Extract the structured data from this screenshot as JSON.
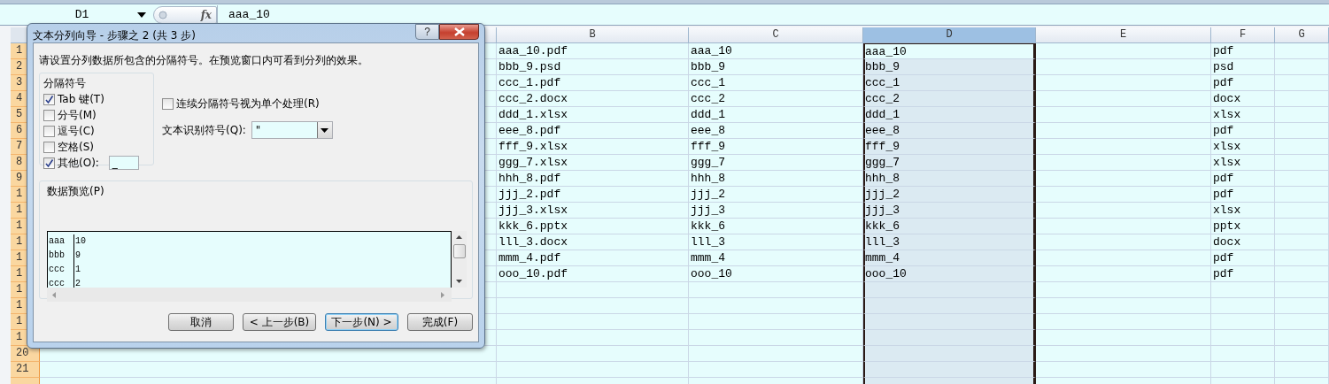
{
  "formula_bar": {
    "name_box": "D1",
    "function_label": "fx",
    "formula": "aaa_10"
  },
  "sheet": {
    "columns": [
      {
        "label": "B",
        "selected": false
      },
      {
        "label": "C",
        "selected": false
      },
      {
        "label": "D",
        "selected": true
      },
      {
        "label": "E",
        "selected": false
      },
      {
        "label": "F",
        "selected": false
      },
      {
        "label": "G",
        "selected": false
      }
    ],
    "rows": [
      {
        "header": "1",
        "cells": [
          "aaa_10.pdf",
          "aaa_10",
          "aaa_10",
          null,
          "pdf",
          null
        ]
      },
      {
        "header": "2",
        "cells": [
          "bbb_9.psd",
          "bbb_9",
          "bbb_9",
          null,
          "psd",
          null
        ]
      },
      {
        "header": "3",
        "cells": [
          "ccc_1.pdf",
          "ccc_1",
          "ccc_1",
          null,
          "pdf",
          null
        ]
      },
      {
        "header": "4",
        "cells": [
          "ccc_2.docx",
          "ccc_2",
          "ccc_2",
          null,
          "docx",
          null
        ]
      },
      {
        "header": "5",
        "cells": [
          "ddd_1.xlsx",
          "ddd_1",
          "ddd_1",
          null,
          "xlsx",
          null
        ]
      },
      {
        "header": "6",
        "cells": [
          "eee_8.pdf",
          "eee_8",
          "eee_8",
          null,
          "pdf",
          null
        ]
      },
      {
        "header": "7",
        "cells": [
          "fff_9.xlsx",
          "fff_9",
          "fff_9",
          null,
          "xlsx",
          null
        ]
      },
      {
        "header": "8",
        "cells": [
          "ggg_7.xlsx",
          "ggg_7",
          "ggg_7",
          null,
          "xlsx",
          null
        ]
      },
      {
        "header": "9",
        "cells": [
          "hhh_8.pdf",
          "hhh_8",
          "hhh_8",
          null,
          "pdf",
          null
        ]
      },
      {
        "header": "1",
        "cells": [
          "jjj_2.pdf",
          "jjj_2",
          "jjj_2",
          null,
          "pdf",
          null
        ]
      },
      {
        "header": "1",
        "cells": [
          "jjj_3.xlsx",
          "jjj_3",
          "jjj_3",
          null,
          "xlsx",
          null
        ]
      },
      {
        "header": "1",
        "cells": [
          "kkk_6.pptx",
          "kkk_6",
          "kkk_6",
          null,
          "pptx",
          null
        ]
      },
      {
        "header": "1",
        "cells": [
          "lll_3.docx",
          "lll_3",
          "lll_3",
          null,
          "docx",
          null
        ]
      },
      {
        "header": "1",
        "cells": [
          "mmm_4.pdf",
          "mmm_4",
          "mmm_4",
          null,
          "pdf",
          null
        ]
      },
      {
        "header": "1",
        "cells": [
          "ooo_10.pdf",
          "ooo_10",
          "ooo_10",
          null,
          "pdf",
          null
        ]
      },
      {
        "header": "1"
      },
      {
        "header": "1"
      },
      {
        "header": "1"
      },
      {
        "header": "1"
      },
      {
        "header": "20"
      },
      {
        "header": "21"
      },
      {}
    ]
  },
  "dialog": {
    "title": "文本分列向导 - 步骤之 2 (共 3 步)",
    "help_button": "?",
    "instruction": "请设置分列数据所包含的分隔符号。在预览窗口内可看到分列的效果。",
    "delimiters": {
      "title": "分隔符号",
      "options": [
        {
          "label": "Tab 键(T)",
          "checked": true
        },
        {
          "label": "分号(M)",
          "checked": false
        },
        {
          "label": "逗号(C)",
          "checked": false
        },
        {
          "label": "空格(S)",
          "checked": false
        },
        {
          "label": "其他(O):",
          "checked": true,
          "value": "_"
        }
      ]
    },
    "consecutive": {
      "label": "连续分隔符号视为单个处理(R)",
      "checked": false
    },
    "qualifier": {
      "label": "文本识别符号(Q):",
      "value": "\""
    },
    "preview": {
      "title": "数据预览(P)",
      "rows": [
        [
          "aaa",
          "10"
        ],
        [
          "bbb",
          "9"
        ],
        [
          "ccc",
          "1"
        ],
        [
          "ccc",
          "2"
        ]
      ]
    },
    "buttons": [
      {
        "label": "取消",
        "default": false
      },
      {
        "label": "< 上一步(B)",
        "default": false
      },
      {
        "label": "下一步(N) >",
        "default": true
      },
      {
        "label": "完成(F)",
        "default": false
      }
    ]
  }
}
